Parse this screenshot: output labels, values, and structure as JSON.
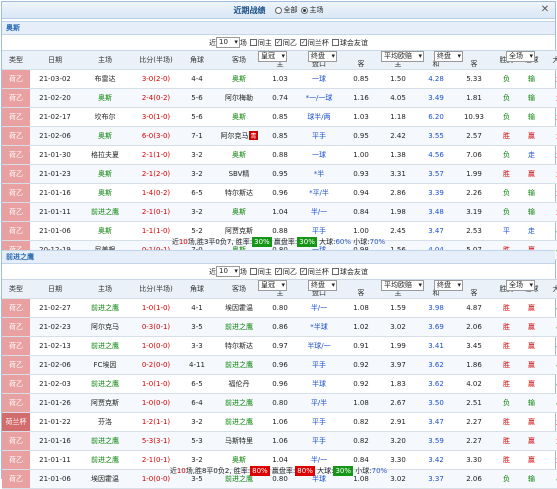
{
  "title": {
    "label": "近期战绩",
    "options": [
      "全部",
      "主场"
    ],
    "selected": 1,
    "close": "✕"
  },
  "sections": [
    {
      "team": "奥斯",
      "controls": {
        "recent_label": "近",
        "count": "10",
        "count_suffix": "场",
        "filters": [
          "同主",
          "同乙",
          "同兰杯",
          "球会友谊"
        ],
        "company": "皇冠",
        "period": "终盘",
        "odds_company": "平均欧赔",
        "odds_period": "终盘",
        "range": "全场"
      },
      "headers": [
        "类型",
        "日期",
        "主场",
        "比分(半场)",
        "角球",
        "客场",
        "主",
        "盘口",
        "客",
        "主",
        "和",
        "客",
        "胜负",
        "让球",
        "大小"
      ],
      "rows": [
        {
          "type": "荷乙",
          "date": "21-03-02",
          "home": "布雷达",
          "score": "3-0(2-0)",
          "corner": "4-4",
          "away": "奥斯",
          "h": "1.03",
          "line": "一球",
          "a": "0.85",
          "o1": "1.50",
          "ox": "4.28",
          "o2": "5.33",
          "wl": "负",
          "hc": "输",
          "ou": "大",
          "hl": "away"
        },
        {
          "type": "荷乙",
          "date": "21-02-20",
          "home": "奥斯",
          "score": "2-4(0-2)",
          "corner": "5-6",
          "away": "阿尔梅勒",
          "h": "0.74",
          "line": "*一/一球",
          "a": "1.16",
          "o1": "4.05",
          "ox": "3.49",
          "o2": "1.81",
          "wl": "负",
          "hc": "输",
          "ou": "大",
          "hl": "home"
        },
        {
          "type": "荷乙",
          "date": "21-02-17",
          "home": "坎布尔",
          "score": "3-0(1-0)",
          "corner": "5-6",
          "away": "奥斯",
          "h": "0.85",
          "line": "球半/两",
          "a": "1.03",
          "o1": "1.18",
          "ox": "6.20",
          "o2": "10.93",
          "wl": "负",
          "hc": "输",
          "ou": "大",
          "hl": "away"
        },
        {
          "type": "荷乙",
          "date": "21-02-06",
          "home": "奥斯",
          "score": "6-0(3-0)",
          "corner": "7-1",
          "away": "阿尔克马",
          "h": "0.85",
          "line": "平手",
          "a": "0.95",
          "o1": "2.42",
          "ox": "3.55",
          "o2": "2.57",
          "wl": "胜",
          "hc": "赢",
          "ou": "大",
          "hl": "home",
          "tag": "青"
        },
        {
          "type": "荷乙",
          "date": "21-01-30",
          "home": "格拉夫夏",
          "score": "2-1(1-0)",
          "corner": "3-2",
          "away": "奥斯",
          "h": "0.88",
          "line": "一球",
          "a": "1.00",
          "o1": "1.38",
          "ox": "4.56",
          "o2": "7.06",
          "wl": "负",
          "hc": "走",
          "ou": "大",
          "hl": "away"
        },
        {
          "type": "荷乙",
          "date": "21-01-23",
          "home": "奥斯",
          "score": "2-1(2-0)",
          "corner": "3-2",
          "away": "SBV精",
          "h": "0.95",
          "line": "*半",
          "a": "0.93",
          "o1": "3.31",
          "ox": "3.57",
          "o2": "1.99",
          "wl": "胜",
          "hc": "赢",
          "ou": "大",
          "hl": "home"
        },
        {
          "type": "荷乙",
          "date": "21-01-16",
          "home": "奥斯",
          "score": "1-4(0-2)",
          "corner": "6-5",
          "away": "特尔斯达",
          "h": "0.96",
          "line": "*平/半",
          "a": "0.94",
          "o1": "2.86",
          "ox": "3.39",
          "o2": "2.26",
          "wl": "负",
          "hc": "输",
          "ou": "大",
          "hl": "home"
        },
        {
          "type": "荷乙",
          "date": "21-01-11",
          "home": "前进之鹰",
          "score": "2-1(0-1)",
          "corner": "3-2",
          "away": "奥斯",
          "h": "1.04",
          "line": "半/一",
          "a": "0.84",
          "o1": "1.98",
          "ox": "3.48",
          "o2": "3.19",
          "wl": "负",
          "hc": "输",
          "ou": "大",
          "hl": "away"
        },
        {
          "type": "荷乙",
          "date": "21-01-06",
          "home": "奥斯",
          "score": "1-1(1-0)",
          "corner": "5-2",
          "away": "阿贾克斯",
          "h": "0.88",
          "line": "平手",
          "a": "1.00",
          "o1": "2.45",
          "ox": "3.47",
          "o2": "2.53",
          "wl": "平",
          "hc": "走",
          "ou": "小",
          "hl": "home"
        },
        {
          "type": "荷乙",
          "date": "20-12-19",
          "home": "尼美根",
          "score": "0-1(0-1)",
          "corner": "7-0",
          "away": "奥斯",
          "h": "0.80",
          "line": "一球",
          "a": "0.98",
          "o1": "1.56",
          "ox": "4.04",
          "o2": "5.07",
          "wl": "胜",
          "hc": "赢",
          "ou": "小",
          "hl": "away"
        }
      ],
      "summary": {
        "prefix": "近",
        "n": "10",
        "mid": "场,胜3平0负7, 胜率:",
        "win": "30%",
        "gl_label": " 赢盘率:",
        "gl": "30%",
        "big_label": " 大球:",
        "big": "60%",
        "small_label": " 小球:",
        "small": "70%"
      }
    },
    {
      "team": "前进之鹰",
      "controls": {
        "recent_label": "近",
        "count": "10",
        "count_suffix": "场",
        "filters": [
          "同主",
          "同乙",
          "同兰杯",
          "球会友谊"
        ],
        "company": "皇冠",
        "period": "终盘",
        "odds_company": "平均欧赔",
        "odds_period": "终盘",
        "range": "全场"
      },
      "headers": [
        "类型",
        "日期",
        "主场",
        "比分(半场)",
        "角球",
        "客场",
        "主",
        "盘口",
        "客",
        "主",
        "和",
        "客",
        "胜负",
        "让球",
        "大小"
      ],
      "rows": [
        {
          "type": "荷乙",
          "date": "21-02-27",
          "home": "前进之鹰",
          "score": "1-0(1-0)",
          "corner": "4-1",
          "away": "埃因霍温",
          "h": "0.80",
          "line": "半/一",
          "a": "1.08",
          "o1": "1.59",
          "ox": "3.98",
          "o2": "4.87",
          "wl": "胜",
          "hc": "赢",
          "ou": "小",
          "hl": "home"
        },
        {
          "type": "荷乙",
          "date": "21-02-23",
          "home": "阿尔克马",
          "score": "0-3(0-1)",
          "corner": "3-5",
          "away": "前进之鹰",
          "h": "0.86",
          "line": "*半球",
          "a": "1.02",
          "o1": "3.02",
          "ox": "3.69",
          "o2": "2.06",
          "wl": "胜",
          "hc": "赢",
          "ou": "小",
          "hl": "away"
        },
        {
          "type": "荷乙",
          "date": "21-02-13",
          "home": "前进之鹰",
          "score": "1-0(0-0)",
          "corner": "3-3",
          "away": "特尔斯达",
          "h": "0.97",
          "line": "半球/一",
          "a": "0.91",
          "o1": "1.99",
          "ox": "3.41",
          "o2": "3.45",
          "wl": "胜",
          "hc": "赢",
          "ou": "小",
          "hl": "home"
        },
        {
          "type": "荷乙",
          "date": "21-02-06",
          "home": "FC埃因",
          "score": "0-2(0-0)",
          "corner": "4-11",
          "away": "前进之鹰",
          "h": "0.96",
          "line": "平手",
          "a": "0.92",
          "o1": "3.97",
          "ox": "3.62",
          "o2": "1.86",
          "wl": "胜",
          "hc": "赢",
          "ou": "小",
          "hl": "away"
        },
        {
          "type": "荷乙",
          "date": "21-02-03",
          "home": "前进之鹰",
          "score": "1-0(1-0)",
          "corner": "6-5",
          "away": "福伦丹",
          "h": "0.96",
          "line": "半球",
          "a": "0.92",
          "o1": "1.83",
          "ox": "3.62",
          "o2": "4.02",
          "wl": "胜",
          "hc": "赢",
          "ou": "小",
          "hl": "home"
        },
        {
          "type": "荷乙",
          "date": "21-01-26",
          "home": "阿贾克斯",
          "score": "1-0(0-0)",
          "corner": "6-4",
          "away": "前进之鹰",
          "h": "0.80",
          "line": "平/半",
          "a": "1.08",
          "o1": "2.67",
          "ox": "3.50",
          "o2": "2.51",
          "wl": "负",
          "hc": "输",
          "ou": "小",
          "hl": "away"
        },
        {
          "type": "荷兰杯",
          "date": "21-01-22",
          "home": "芬洛",
          "score": "1-2(1-1)",
          "corner": "3-2",
          "away": "前进之鹰",
          "h": "1.06",
          "line": "平手",
          "a": "0.82",
          "o1": "2.91",
          "ox": "3.47",
          "o2": "2.27",
          "wl": "胜",
          "hc": "赢",
          "ou": "大",
          "hl": "away",
          "cup": true
        },
        {
          "type": "荷乙",
          "date": "21-01-16",
          "home": "前进之鹰",
          "score": "5-3(3-1)",
          "corner": "5-3",
          "away": "马斯特里",
          "h": "1.06",
          "line": "平手",
          "a": "0.82",
          "o1": "3.20",
          "ox": "3.59",
          "o2": "2.27",
          "wl": "胜",
          "hc": "赢",
          "ou": "大",
          "hl": "home"
        },
        {
          "type": "荷乙",
          "date": "21-01-11",
          "home": "前进之鹰",
          "score": "2-1(0-1)",
          "corner": "3-2",
          "away": "奥斯",
          "h": "1.04",
          "line": "半/一",
          "a": "0.84",
          "o1": "3.30",
          "ox": "3.42",
          "o2": "3.30",
          "wl": "胜",
          "hc": "赢",
          "ou": "大",
          "hl": "home"
        },
        {
          "type": "荷乙",
          "date": "21-01-06",
          "home": "埃因霍温",
          "score": "1-0(0-0)",
          "corner": "3-5",
          "away": "前进之鹰",
          "h": "0.80",
          "line": "半球",
          "a": "1.08",
          "o1": "3.02",
          "ox": "3.37",
          "o2": "2.06",
          "wl": "负",
          "hc": "输",
          "ou": "小",
          "hl": "away"
        }
      ],
      "summary": {
        "prefix": "近",
        "n": "10",
        "mid": "场,胜8平0负2, 胜率:",
        "win": "80%",
        "gl_label": " 赢盘率:",
        "gl": "80%",
        "big_label": " 大球:",
        "big": "30%",
        "small_label": " 小球:",
        "small": "70%"
      }
    }
  ]
}
